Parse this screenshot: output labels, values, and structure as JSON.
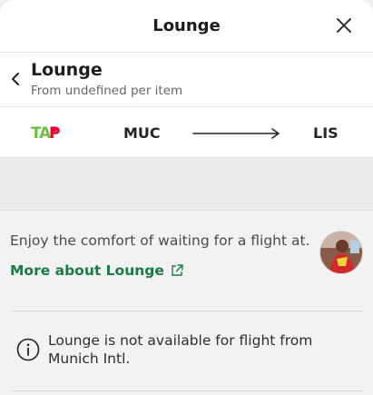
{
  "modal": {
    "title": "Lounge",
    "close_icon": "close-icon"
  },
  "subheader": {
    "back_icon": "chevron-left-icon",
    "title": "Lounge",
    "caption": "From undefined per item"
  },
  "route": {
    "airline_logo_text": "TAP",
    "origin": "MUC",
    "destination": "LIS",
    "arrow_icon": "arrow-right-icon"
  },
  "info": {
    "intro": "Enjoy the comfort of waiting for a flight at.",
    "more_link": "More about Lounge",
    "more_link_icon": "external-link-icon"
  },
  "notice": {
    "icon": "info-icon",
    "text": "Lounge is not available for flight from Munich Intl."
  },
  "colors": {
    "link": "#1c7a45",
    "tap_green": "#6cbe45",
    "tap_red": "#e4002b"
  }
}
